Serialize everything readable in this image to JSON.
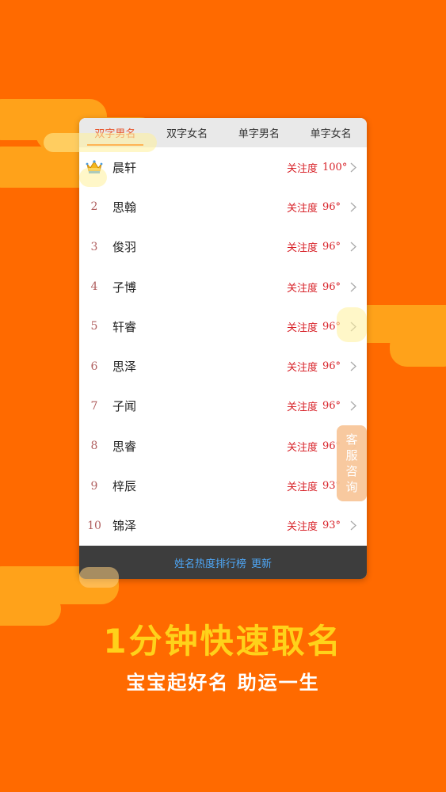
{
  "tabs": [
    "双字男名",
    "双字女名",
    "单字男名",
    "单字女名"
  ],
  "active_tab": 0,
  "attention_label": "关注度",
  "rows": [
    {
      "rank": "",
      "name": "晨轩",
      "score": "100°",
      "crown": true
    },
    {
      "rank": "2",
      "name": "思翰",
      "score": "96°"
    },
    {
      "rank": "3",
      "name": "俊羽",
      "score": "96°"
    },
    {
      "rank": "4",
      "name": "子博",
      "score": "96°"
    },
    {
      "rank": "5",
      "name": "轩睿",
      "score": "96°"
    },
    {
      "rank": "6",
      "name": "思泽",
      "score": "96°"
    },
    {
      "rank": "7",
      "name": "子闻",
      "score": "96°"
    },
    {
      "rank": "8",
      "name": "思睿",
      "score": "96°"
    },
    {
      "rank": "9",
      "name": "梓辰",
      "score": "93°"
    },
    {
      "rank": "10",
      "name": "锦泽",
      "score": "93°"
    }
  ],
  "footer": {
    "title": "姓名热度排行榜",
    "update": "更新"
  },
  "service_button": [
    "客",
    "服",
    "咨",
    "询"
  ],
  "slogan": "1分钟快速取名",
  "subtitle": "宝宝起好名 助运一生",
  "colors": {
    "background": "#ff6a00",
    "cloud": "#ffa21a",
    "accent": "#d8232a",
    "slogan": "#ffd21a",
    "footer_link": "#4ea6f5"
  }
}
